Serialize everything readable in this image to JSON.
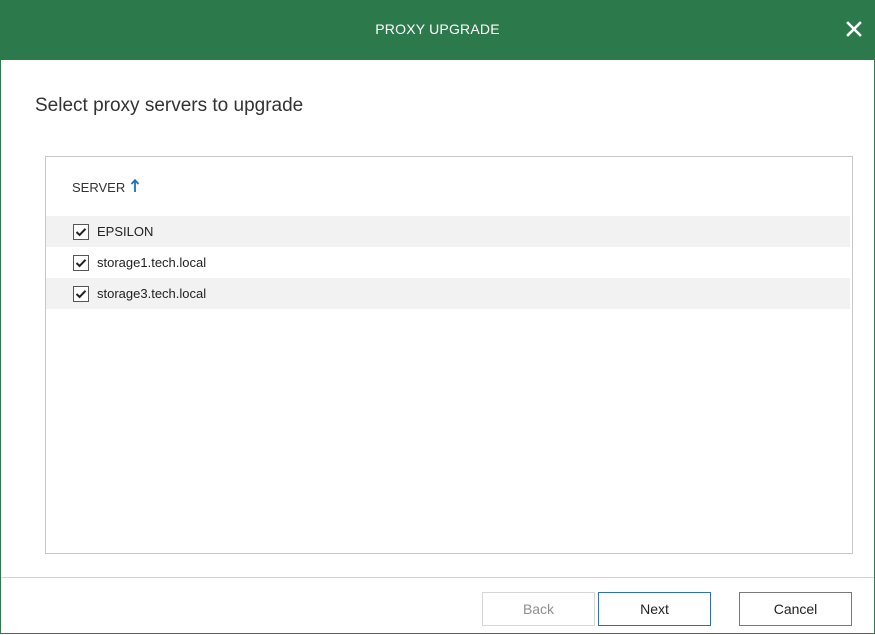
{
  "window": {
    "title": "PROXY UPGRADE",
    "close_icon": "close-icon"
  },
  "page": {
    "heading": "Select proxy servers to upgrade"
  },
  "list": {
    "column_header": "SERVER",
    "sort_icon": "arrow-up-icon",
    "accent_color": "#1a6fc4",
    "rows": [
      {
        "label": "EPSILON",
        "checked": true
      },
      {
        "label": "storage1.tech.local",
        "checked": true
      },
      {
        "label": "storage3.tech.local",
        "checked": true
      }
    ]
  },
  "footer": {
    "back_label": "Back",
    "next_label": "Next",
    "cancel_label": "Cancel",
    "back_disabled": true
  },
  "colors": {
    "titlebar": "#2c7a4b",
    "primary_border": "#2f6fb5"
  }
}
